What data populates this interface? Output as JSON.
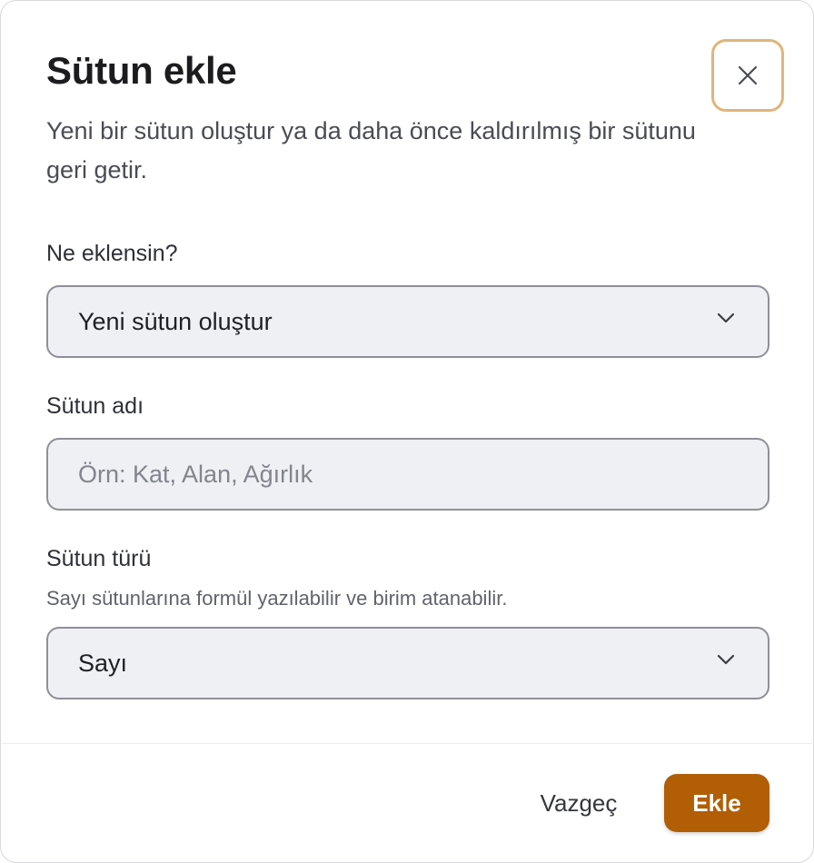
{
  "dialog": {
    "title": "Sütun ekle",
    "description": "Yeni bir sütun oluştur ya da daha önce kaldırılmış bir sütunu geri getir.",
    "close_icon": "close-icon"
  },
  "fields": {
    "mode": {
      "label": "Ne eklensin?",
      "selected": "Yeni sütun oluştur",
      "icon": "chevron-down-icon"
    },
    "name": {
      "label": "Sütun adı",
      "value": "",
      "placeholder": "Örn: Kat, Alan, Ağırlık"
    },
    "type": {
      "label": "Sütun türü",
      "hint": "Sayı sütunlarına formül yazılabilir ve birim atanabilir.",
      "selected": "Sayı",
      "icon": "chevron-down-icon"
    }
  },
  "footer": {
    "cancel_label": "Vazgeç",
    "submit_label": "Ekle"
  },
  "colors": {
    "accent": "#b15e05",
    "focus_ring": "#e0b57c",
    "field_background": "#eff0f3",
    "field_border": "#8e9098"
  }
}
